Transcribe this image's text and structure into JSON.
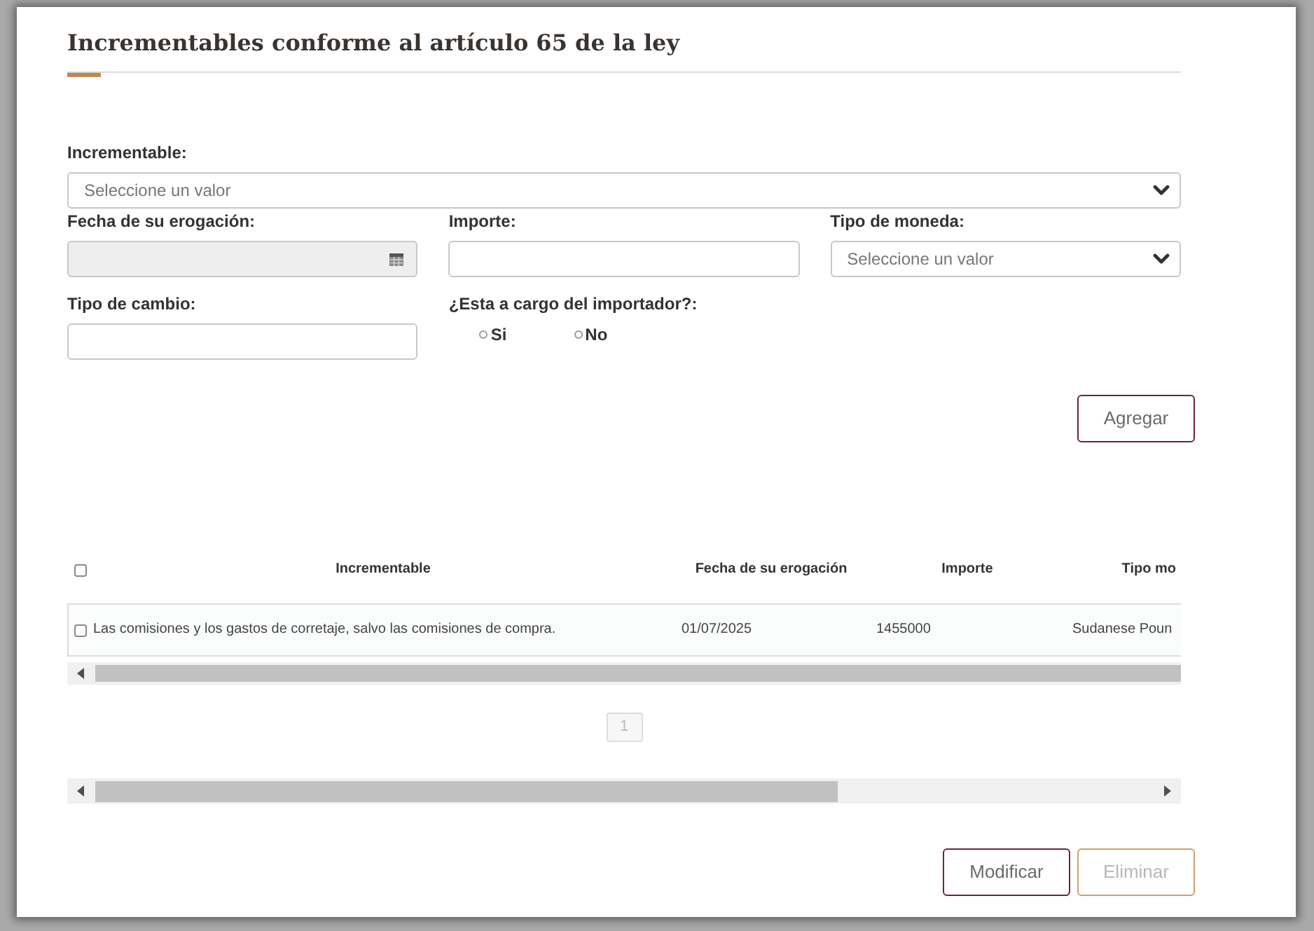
{
  "title": "Incrementables conforme al artículo 65 de la ley",
  "form_rows": [
    [
      {
        "kind": "select",
        "label": "Incrementable:",
        "placeholder": "Seleccione un valor",
        "disabled": false
      }
    ],
    [
      {
        "kind": "date",
        "label": "Fecha de su erogación:",
        "disabled": true
      },
      {
        "kind": "text",
        "label": "Importe:",
        "disabled": false
      },
      {
        "kind": "select",
        "label": "Tipo de moneda:",
        "placeholder": "Seleccione un valor",
        "disabled": false
      }
    ],
    [
      {
        "kind": "text",
        "label": "Tipo de cambio:",
        "disabled": false
      },
      {
        "kind": "radio",
        "label": "¿Esta a cargo del importador?:",
        "disabled": false,
        "options": [
          {
            "label": "Si",
            "selected": false
          },
          {
            "label": "No",
            "selected": false
          }
        ]
      }
    ]
  ],
  "add_button": {
    "label": "Agregar",
    "disabled": false
  },
  "table": {
    "select_all": {
      "checked": false
    },
    "columns": [
      "Incrementable",
      "Fecha de su erogación",
      "Importe",
      "Tipo mo"
    ],
    "rows": [
      {
        "checked": false,
        "cells": [
          "Las comisiones y los gastos de corretaje, salvo las comisiones de compra.",
          "01/07/2025",
          "1455000",
          "Sudanese Poun"
        ]
      }
    ]
  },
  "pagination": [
    {
      "label": "1",
      "disabled": true
    }
  ],
  "actions": [
    {
      "label": "Modificar",
      "disabled": false
    },
    {
      "label": "Eliminar",
      "disabled": true
    }
  ]
}
